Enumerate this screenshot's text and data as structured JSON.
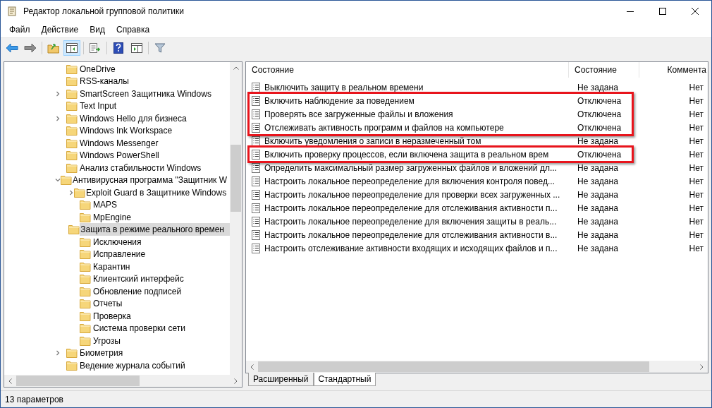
{
  "window": {
    "title": "Редактор локальной групповой политики"
  },
  "menu": [
    "Файл",
    "Действие",
    "Вид",
    "Справка"
  ],
  "tree": {
    "items": [
      {
        "label": "OneDrive",
        "kind": "leaf",
        "selected": false
      },
      {
        "label": "RSS-каналы",
        "kind": "leaf",
        "selected": false
      },
      {
        "label": "SmartScreen Защитника Windows",
        "kind": "collapsed",
        "selected": false
      },
      {
        "label": "Text Input",
        "kind": "leaf",
        "selected": false
      },
      {
        "label": "Windows Hello для бизнеса",
        "kind": "collapsed",
        "selected": false
      },
      {
        "label": "Windows Ink Workspace",
        "kind": "leaf",
        "selected": false
      },
      {
        "label": "Windows Messenger",
        "kind": "leaf",
        "selected": false
      },
      {
        "label": "Windows PowerShell",
        "kind": "leaf",
        "selected": false
      },
      {
        "label": "Анализ стабильности Windows",
        "kind": "leaf",
        "selected": false
      },
      {
        "label": "Антивирусная программа \"Защитник W",
        "kind": "expanded",
        "selected": false,
        "children": [
          {
            "label": "Exploit Guard в Защитнике Windows",
            "kind": "collapsed",
            "selected": false
          },
          {
            "label": "MAPS",
            "kind": "leaf",
            "selected": false
          },
          {
            "label": "MpEngine",
            "kind": "leaf",
            "selected": false
          },
          {
            "label": "Защита в режиме реального времен",
            "kind": "leaf",
            "selected": true
          },
          {
            "label": "Исключения",
            "kind": "leaf",
            "selected": false
          },
          {
            "label": "Исправление",
            "kind": "leaf",
            "selected": false
          },
          {
            "label": "Карантин",
            "kind": "leaf",
            "selected": false
          },
          {
            "label": "Клиентский интерфейс",
            "kind": "leaf",
            "selected": false
          },
          {
            "label": "Обновление подписей",
            "kind": "leaf",
            "selected": false
          },
          {
            "label": "Отчеты",
            "kind": "leaf",
            "selected": false
          },
          {
            "label": "Проверка",
            "kind": "leaf",
            "selected": false
          },
          {
            "label": "Система проверки сети",
            "kind": "leaf",
            "selected": false
          },
          {
            "label": "Угрозы",
            "kind": "leaf",
            "selected": false
          }
        ]
      },
      {
        "label": "Биометрия",
        "kind": "collapsed",
        "selected": false
      },
      {
        "label": "Ведение журнала событий",
        "kind": "leaf",
        "selected": false
      }
    ]
  },
  "table": {
    "columns": [
      "Состояние",
      "Состояние",
      "Коммента"
    ],
    "rows": [
      {
        "name": "Выключить защиту в реальном времени",
        "state": "Не задана",
        "comment": "Нет",
        "highlighted": false
      },
      {
        "name": "Включить наблюдение за поведением",
        "state": "Отключена",
        "comment": "Нет",
        "highlighted": true
      },
      {
        "name": "Проверять все загруженные файлы и вложения",
        "state": "Отключена",
        "comment": "Нет",
        "highlighted": true
      },
      {
        "name": "Отслеживать активность программ и файлов на компьютере",
        "state": "Отключена",
        "comment": "Нет",
        "highlighted": true
      },
      {
        "name": "Включить уведомления о записи в неразмеченный том",
        "state": "Не задана",
        "comment": "Нет",
        "highlighted": false
      },
      {
        "name": "Включить проверку процессов, если включена защита в реальном врем",
        "state": "Отключена",
        "comment": "Нет",
        "highlighted": true
      },
      {
        "name": "Определить максимальный размер загруженных файлов и вложений дл...",
        "state": "Не задана",
        "comment": "Нет",
        "highlighted": false
      },
      {
        "name": "Настроить локальное переопределение для включения контроля повед...",
        "state": "Не задана",
        "comment": "Нет",
        "highlighted": false
      },
      {
        "name": "Настроить локальное переопределение для проверки всех загруженных ...",
        "state": "Не задана",
        "comment": "Нет",
        "highlighted": false
      },
      {
        "name": "Настроить локальное переопределение для отслеживания активности п...",
        "state": "Не задана",
        "comment": "Нет",
        "highlighted": false
      },
      {
        "name": "Настроить локальное переопределение для включения защиты в реаль...",
        "state": "Не задана",
        "comment": "Нет",
        "highlighted": false
      },
      {
        "name": "Настроить локальное переопределение для отслеживания активности в...",
        "state": "Не задана",
        "comment": "Нет",
        "highlighted": false
      },
      {
        "name": "Настроить отслеживание активности входящих и исходящих файлов и п...",
        "state": "Не задана",
        "comment": "Нет",
        "highlighted": false
      }
    ]
  },
  "tabs": [
    {
      "label": "Расширенный",
      "selected": false
    },
    {
      "label": "Стандартный",
      "selected": true
    }
  ],
  "status_bar": "13 параметров"
}
